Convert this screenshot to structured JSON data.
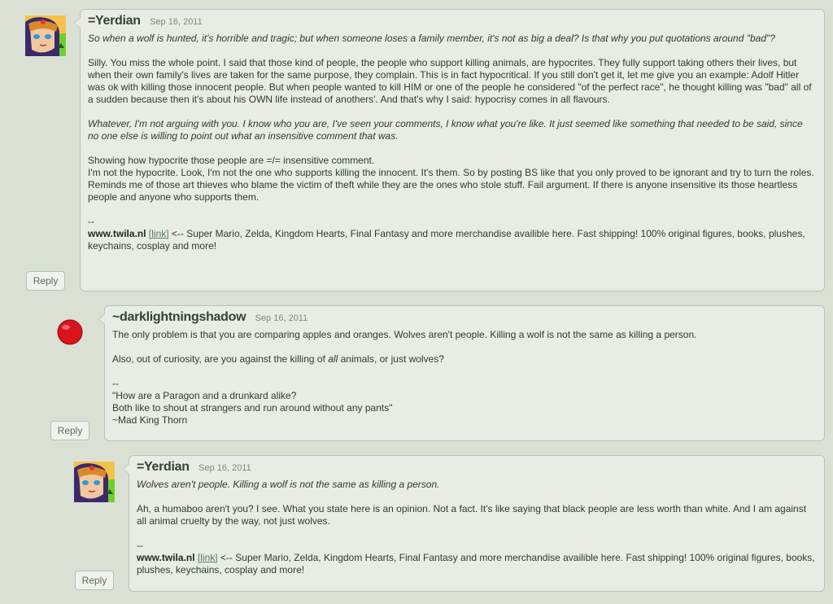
{
  "comments": [
    {
      "username": "=Yerdian",
      "date": "Sep 16, 2011",
      "reply_label": "Reply",
      "paragraphs": [
        "So when a wolf is hunted, it's horrible and tragic; but when someone loses a family member, it's not as big a deal? Is that why you put quotations around \"bad\"?",
        "Silly. You miss the whole point. I said that those kind of people, the people who support killing animals, are hypocrites. They fully support taking others their lives, but when their own family's lives are taken for the same purpose, they complain. This is in fact hypocritical. If you still don't get it, let me give you an example: Adolf Hitler was ok with killing those innocent people. But when people wanted to kill HIM or one of the people he considered \"of the perfect race\", he thought killing was \"bad\" all of a sudden because then it's about his OWN life instead of anothers'. And that's why I said: hypocrisy comes in all flavours.",
        "Whatever, I'm not arguing with you. I know who you are, I've seen your comments, I know what you're like. It just seemed like something that needed to be said, since no one else is willing to point out what an insensitive comment that was.",
        "Showing how hypocrite those people are =/= insensitive comment.",
        "I'm not the hypocrite. Look, I'm not the one who supports killing the innocent. It's them. So by posting BS like that you only proved to be ignorant and try to turn the roles. Reminds me of those art thieves who blame the victim of theft while they are the ones who stole stuff. Fail argument. If there is anyone insensitive its those heartless people and anyone who supports them."
      ],
      "sig_sep": "--",
      "sig_site": "www.twila.nl",
      "sig_link": "[link]",
      "sig_text": " <-- Super Mario, Zelda, Kingdom Hearts, Final Fantasy and more merchandise availible here. Fast shipping! 100% original figures, books, plushes, keychains, cosplay and more!"
    },
    {
      "username": "~darklightningshadow",
      "date": "Sep 16, 2011",
      "reply_label": "Reply",
      "p1": "The only problem is that you are comparing apples and oranges. Wolves aren't people. Killing a wolf is not the same as killing a person.",
      "p2_before": "Also, out of curiosity, are you against the killing of ",
      "p2_em": "all",
      "p2_after": " animals, or just wolves?",
      "sig_sep": "--",
      "sig_line1": "\"How are a Paragon and a drunkard alike?",
      "sig_line2": "Both like to shout at strangers and run around without any pants\"",
      "sig_line3": "~Mad King Thorn"
    },
    {
      "username": "=Yerdian",
      "date": "Sep 16, 2011",
      "reply_label": "Reply",
      "quote": "Wolves aren't people. Killing a wolf is not the same as killing a person.",
      "p1": "Ah, a humaboo aren't you? I see. What you state here is an opinion. Not a fact. It's like saying that black people are less worth than white. And I am against all animal cruelty by the way, not just wolves.",
      "sig_sep": "--",
      "sig_site": "www.twila.nl",
      "sig_link": "[link]",
      "sig_text": " <-- Super Mario, Zelda, Kingdom Hearts, Final Fantasy and more merchandise availible here. Fast shipping! 100% original figures, books, plushes, keychains, cosplay and more!"
    }
  ],
  "colors": {
    "background": "#dae0d4",
    "bubble": "#e8ece4",
    "border": "#b9c4b7",
    "link": "#5a7a66",
    "avatar_dot": "#d9141c"
  }
}
